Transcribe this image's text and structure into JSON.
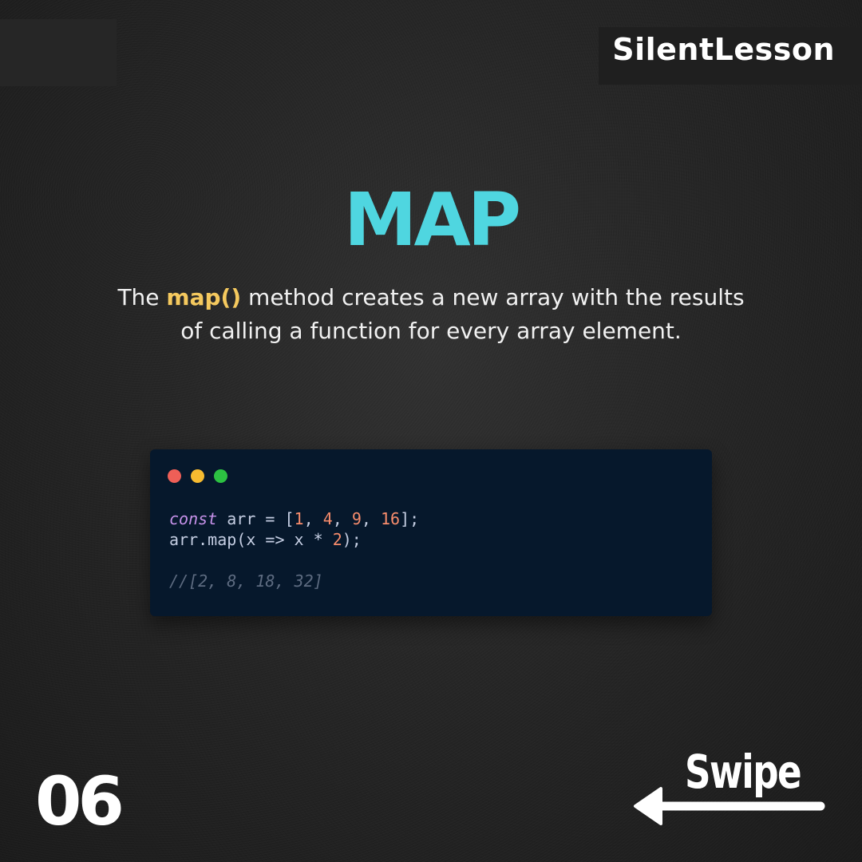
{
  "brand": {
    "name": "SilentLesson"
  },
  "slide": {
    "title": "MAP",
    "description": {
      "before": "The ",
      "highlight": "map()",
      "after": " method creates a new array with the results of calling a function for every array element."
    },
    "page_number": "06",
    "swipe_label": "Swipe"
  },
  "code_window": {
    "dots": [
      "#ee5f57",
      "#f6bb30",
      "#2cc142"
    ],
    "line1": {
      "keyword": "const",
      "text_a": " arr = [",
      "n1": "1",
      "sep1": ", ",
      "n2": "4",
      "sep2": ", ",
      "n3": "9",
      "sep3": ", ",
      "n4": "16",
      "end": "];"
    },
    "line2": {
      "text_a": "arr.map(x => x * ",
      "n1": "2",
      "end": ");"
    },
    "comment": "//[2, 8, 18, 32]"
  },
  "colors": {
    "title": "#4fd6e0",
    "highlight": "#f5c95e",
    "code_background": "#06182c"
  },
  "icons": {
    "swipe": "left-arrow-icon"
  }
}
